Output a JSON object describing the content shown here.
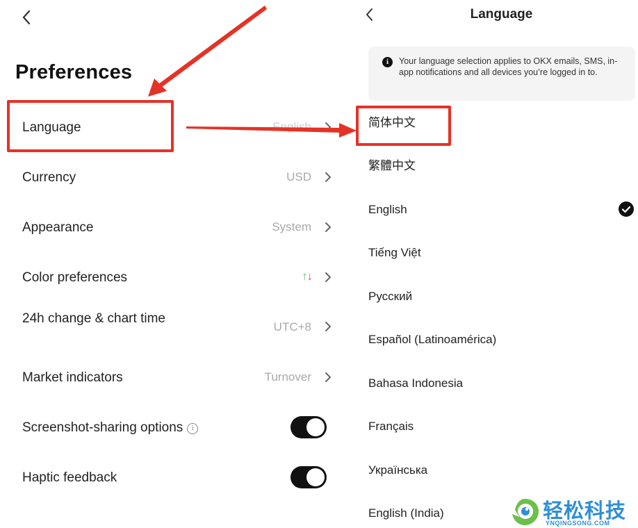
{
  "left": {
    "title": "Preferences",
    "rows": [
      {
        "label": "Language",
        "value": "English"
      },
      {
        "label": "Currency",
        "value": "USD"
      },
      {
        "label": "Appearance",
        "value": "System"
      },
      {
        "label": "Color preferences",
        "value": "",
        "arrows": {
          "up": "↑",
          "down": "↓"
        }
      },
      {
        "label": "24h change & chart time",
        "value": "UTC+8"
      },
      {
        "label": "Market indicators",
        "value": "Turnover"
      },
      {
        "label": "Screenshot-sharing options",
        "value": "",
        "toggle": true
      },
      {
        "label": "Haptic feedback",
        "value": "",
        "toggle": true
      }
    ],
    "info_icon": "i",
    "colors": {
      "up": "#58c55a",
      "down": "#e0458b",
      "toggle_on": "#111111"
    }
  },
  "right": {
    "title": "Language",
    "notice_icon": "i",
    "notice": "Your language selection applies to OKX emails, SMS, in-app notifications and all devices you’re logged in to.",
    "languages": [
      "简体中文",
      "繁體中文",
      "English",
      "Tiếng Việt",
      "Русский",
      "Español (Latinoamérica)",
      "Bahasa Indonesia",
      "Français",
      "Українська",
      "English (India)"
    ],
    "selected": "English"
  },
  "annotation_color": "#e53226",
  "icons": [
    "back-chevron-icon",
    "chevron-right-icon",
    "info-icon",
    "checkmark-icon"
  ],
  "watermark": {
    "cn": "轻松科技",
    "en": "YNQINGSONG.COM"
  }
}
